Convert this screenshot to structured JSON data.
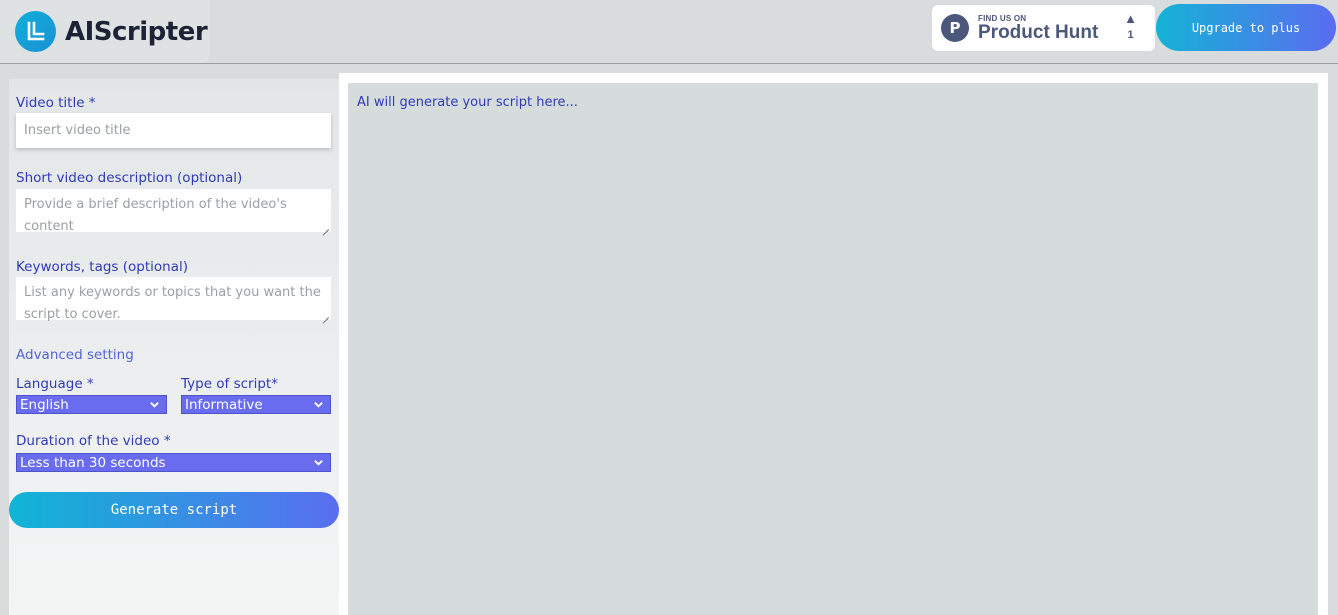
{
  "header": {
    "app_name": "AIScripter",
    "product_hunt": {
      "small_text": "FIND US ON",
      "big_text": "Product Hunt",
      "badge_letter": "P",
      "votes": "1"
    },
    "upgrade_label": "Upgrade to plus"
  },
  "form": {
    "video_title": {
      "label": "Video title *",
      "placeholder": "Insert video title"
    },
    "description": {
      "label": "Short video description (optional)",
      "placeholder": "Provide a brief description of the video's content"
    },
    "keywords": {
      "label": "Keywords, tags (optional)",
      "placeholder": "List any keywords or topics that you want the script to cover."
    },
    "advanced_label": "Advanced setting",
    "language": {
      "label": "Language *",
      "value": "English"
    },
    "script_type": {
      "label": "Type of script*",
      "value": "Informative"
    },
    "duration": {
      "label": "Duration of the video *",
      "value": "Less than 30 seconds"
    },
    "generate_label": "Generate script"
  },
  "output": {
    "placeholder": "AI will generate your script here..."
  },
  "colors": {
    "accent_purple": "#6a6cf0",
    "accent_cyan": "#0fb5d5",
    "label_blue": "#2f3bb7"
  }
}
